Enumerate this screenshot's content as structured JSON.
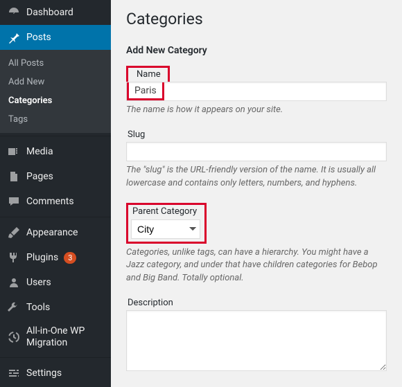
{
  "sidebar": {
    "dashboard": "Dashboard",
    "posts": "Posts",
    "posts_sub": [
      "All Posts",
      "Add New",
      "Categories",
      "Tags"
    ],
    "media": "Media",
    "pages": "Pages",
    "comments": "Comments",
    "appearance": "Appearance",
    "plugins": "Plugins",
    "plugins_badge": "3",
    "users": "Users",
    "tools": "Tools",
    "migration": "All-in-One WP Migration",
    "settings": "Settings"
  },
  "page": {
    "title": "Categories",
    "subtitle": "Add New Category",
    "name_label": "Name",
    "name_value": "Paris",
    "name_desc": "The name is how it appears on your site.",
    "slug_label": "Slug",
    "slug_value": "",
    "slug_desc": "The \"slug\" is the URL-friendly version of the name. It is usually all lowercase and contains only letters, numbers, and hyphens.",
    "parent_label": "Parent Category",
    "parent_value": "City",
    "parent_desc": "Categories, unlike tags, can have a hierarchy. You might have a Jazz category, and under that have children categories for Bebop and Big Band. Totally optional.",
    "desc_label": "Description"
  }
}
